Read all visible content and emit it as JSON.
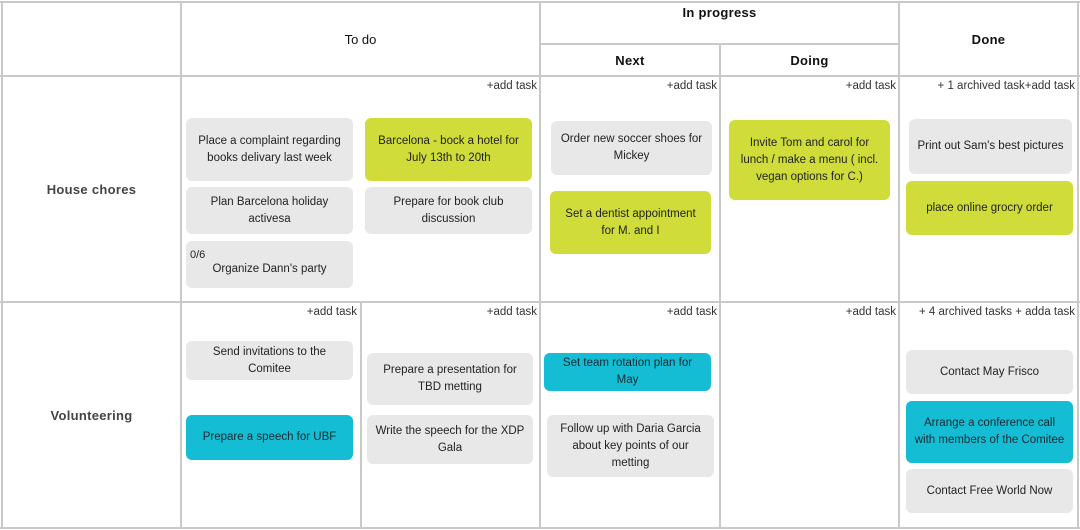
{
  "columns": {
    "todo": "To do",
    "in_progress": "In progress",
    "next": "Next",
    "doing": "Doing",
    "done": "Done"
  },
  "rows": {
    "house_chores": "House chores",
    "volunteering": "Volunteering"
  },
  "colors": {
    "gray_card": "#e8e8e8",
    "lime_card": "#cfdc3a",
    "cyan_card": "#14bcd4",
    "grid_line": "#c9c9c9"
  },
  "house": {
    "todo_add": "+add task",
    "next_add": "+add task",
    "doing_add": "+add task",
    "done_add": "+ 1 archived task+add task",
    "todo": [
      {
        "text": "Place a complaint regarding books delivary last week",
        "color": "gray"
      },
      {
        "text": "Barcelona - bock a hotel for July 13th to 20th",
        "color": "lime"
      },
      {
        "text": "Plan Barcelona holiday activesa",
        "color": "gray"
      },
      {
        "text": "Prepare for book club discussion",
        "color": "gray"
      },
      {
        "text": "Organize Dann's party",
        "counter": "0/6",
        "color": "gray"
      }
    ],
    "next": [
      {
        "text": "Order new soccer shoes for Mickey",
        "color": "gray"
      },
      {
        "text": "Set a dentist appointment for M. and I",
        "color": "lime"
      }
    ],
    "doing": [
      {
        "text": "Invite Tom and carol for lunch / make a menu ( incl. vegan options for C.)",
        "color": "lime"
      }
    ],
    "done": [
      {
        "text": "Print out Sam's best pictures",
        "color": "gray"
      },
      {
        "text": "place online grocry order",
        "color": "lime"
      }
    ]
  },
  "volunteering": {
    "todo_a_add": "+add task",
    "todo_b_add": "+add task",
    "next_add": "+add task",
    "doing_add": "+add task",
    "done_add": "+ 4 archived tasks + adda task",
    "todo_a": [
      {
        "text": "Send invitations to the Comitee",
        "color": "gray"
      },
      {
        "text": "Prepare a speech for UBF",
        "color": "cyan"
      }
    ],
    "todo_b": [
      {
        "text": "Prepare a presentation for TBD metting",
        "color": "gray"
      },
      {
        "text": "Write the speech for the XDP Gala",
        "color": "gray"
      }
    ],
    "next": [
      {
        "text": "Set team rotation plan for May",
        "color": "cyan"
      },
      {
        "text": "Follow up with Daria Garcia about key points of our metting",
        "color": "gray"
      }
    ],
    "done": [
      {
        "text": "Contact May Frisco",
        "color": "gray"
      },
      {
        "text": "Arrange a conference call with members of the Comitee",
        "color": "cyan"
      },
      {
        "text": "Contact Free World Now",
        "color": "gray"
      }
    ]
  }
}
